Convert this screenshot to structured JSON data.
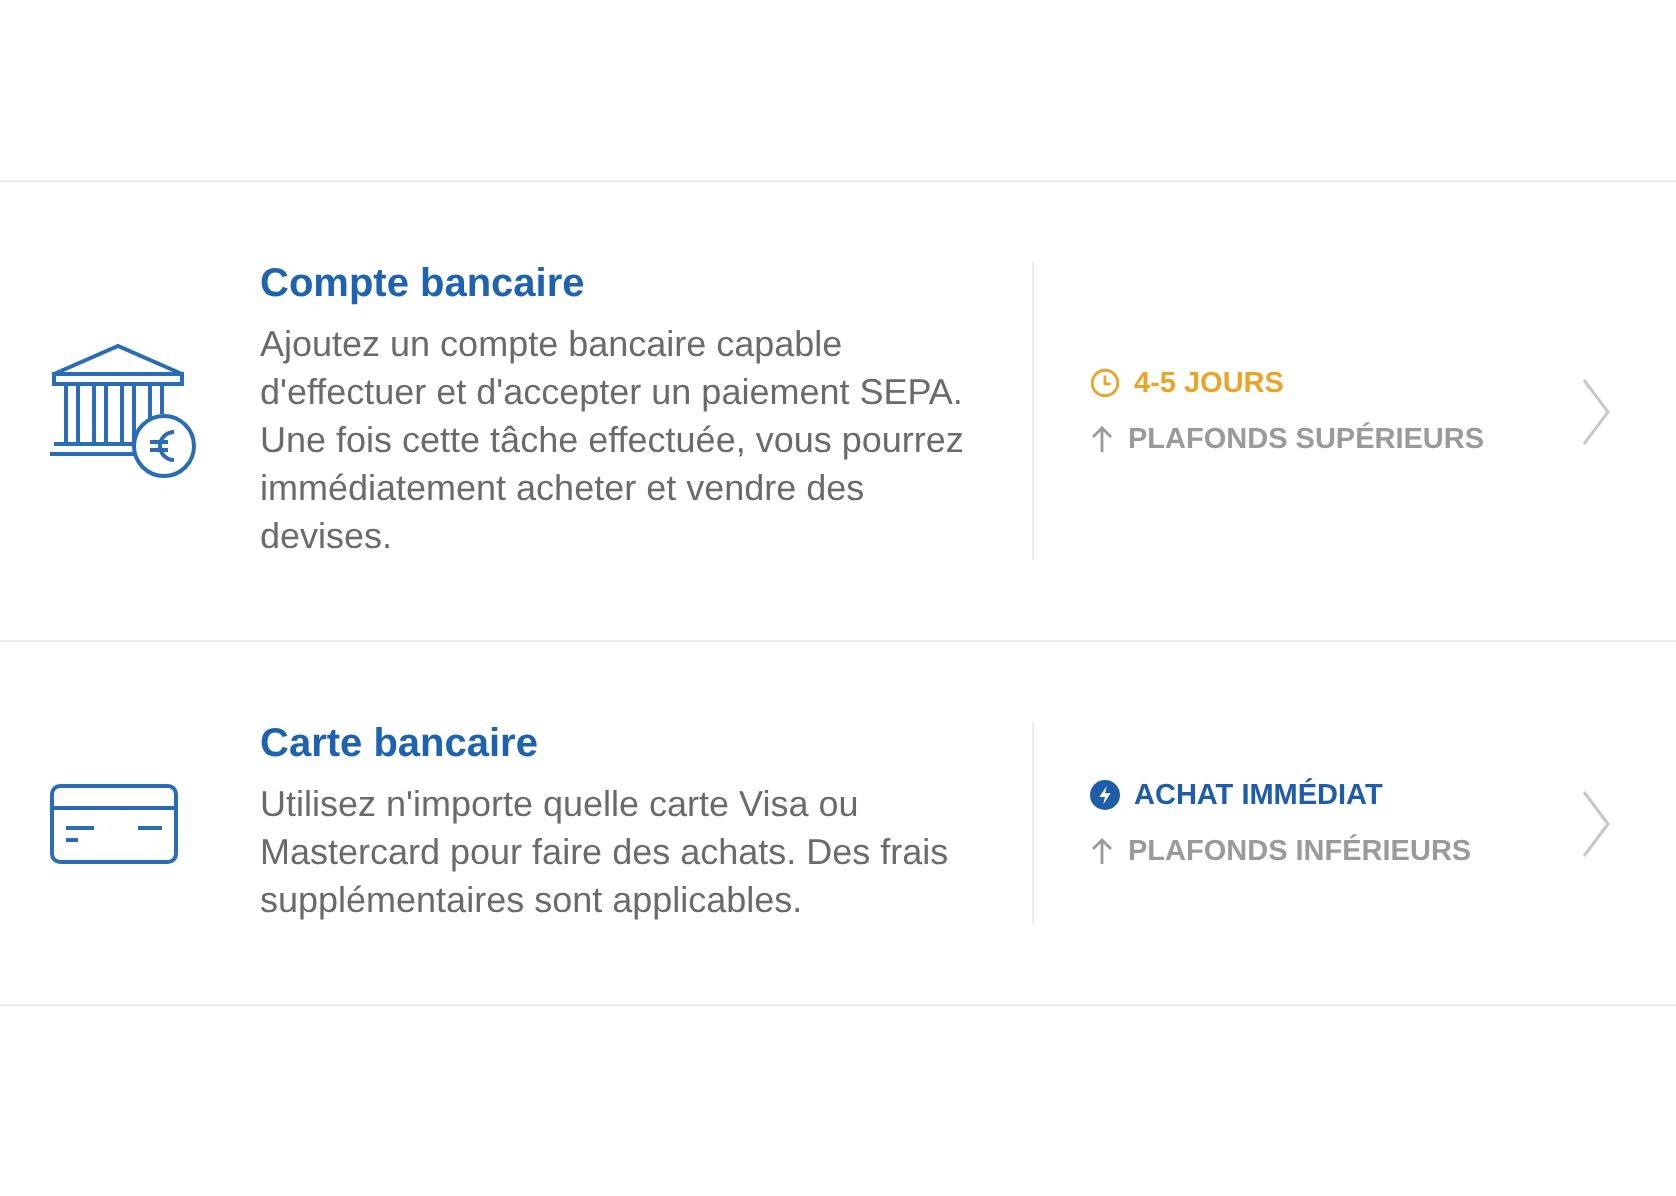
{
  "options": [
    {
      "kind": "bank",
      "title": "Compte bancaire",
      "description": "Ajoutez un compte bancaire capable d'effectuer et d'accepter un paiement SEPA. Une fois cette tâche effectuée, vous pourrez immédiatement acheter et vendre des devises.",
      "speed": {
        "kind": "time",
        "label": "4-5 JOURS"
      },
      "limits": "PLAFONDS SUPÉRIEURS"
    },
    {
      "kind": "card",
      "title": "Carte bancaire",
      "description": "Utilisez n'importe quelle carte Visa ou Mastercard pour faire des achats. Des frais supplémentaires sont applicables.",
      "speed": {
        "kind": "instant",
        "label": "ACHAT IMMÉDIAT"
      },
      "limits": "PLAFONDS INFÉRIEURS"
    }
  ]
}
